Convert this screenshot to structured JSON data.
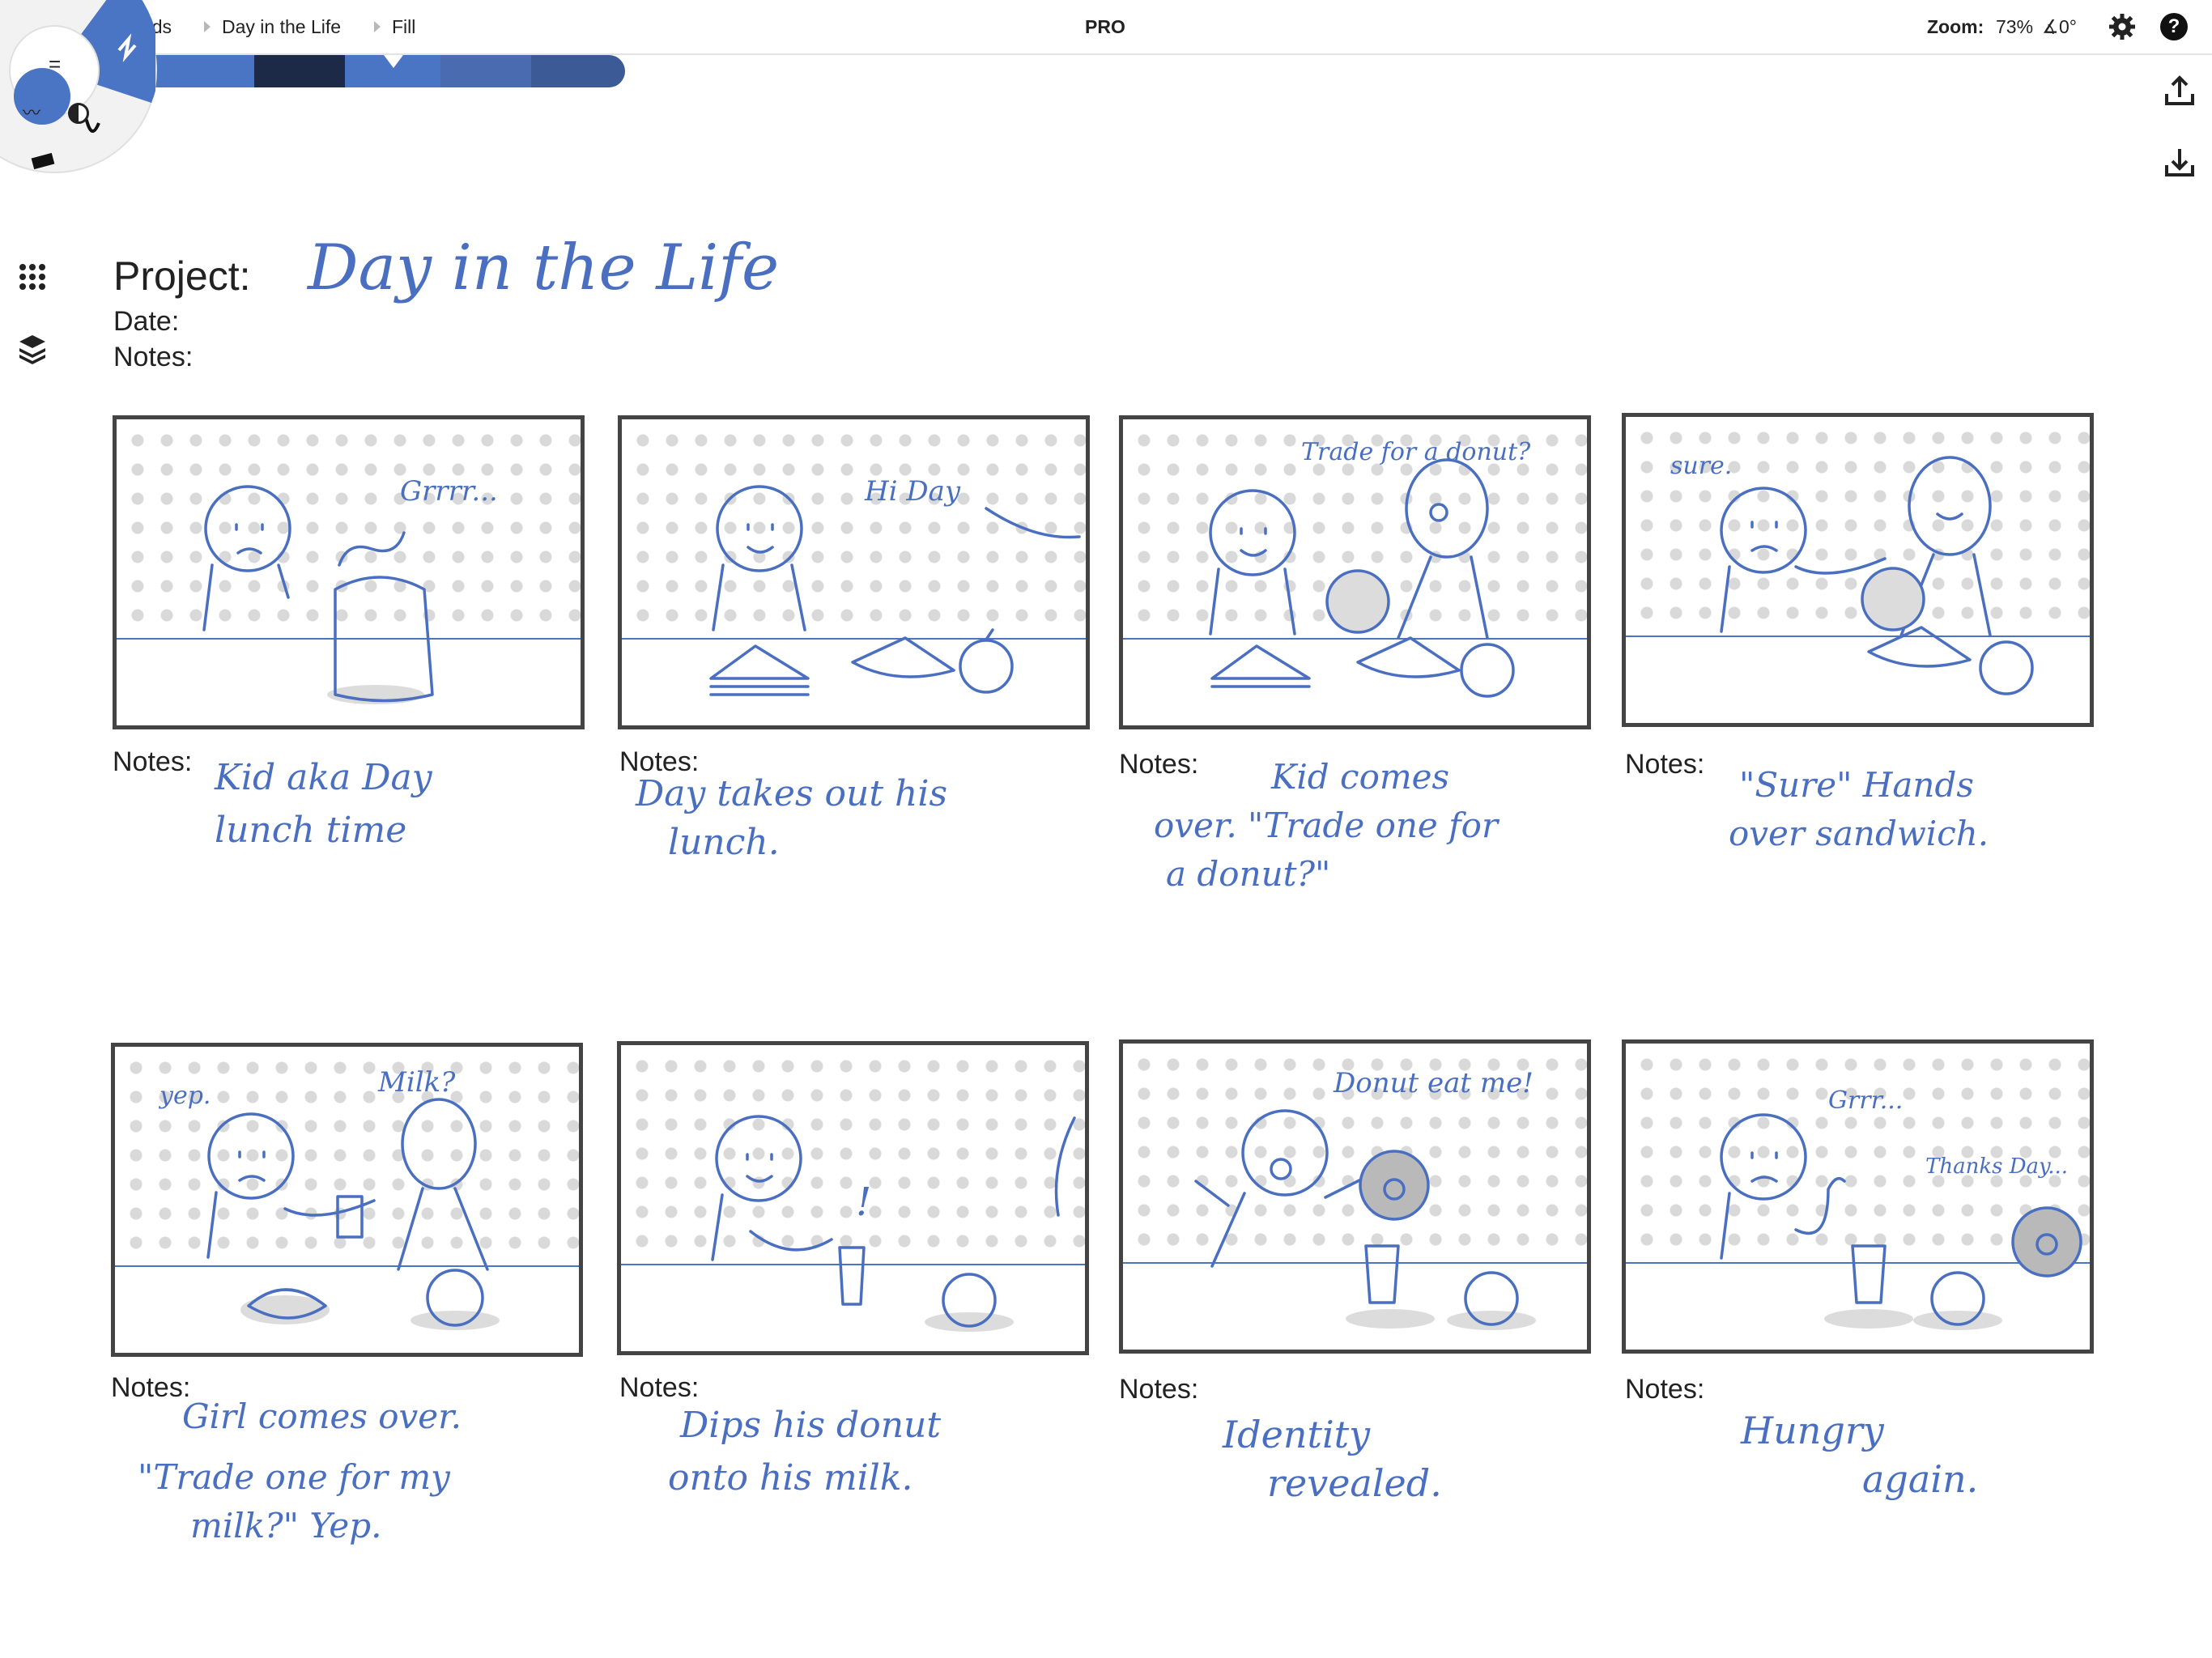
{
  "topbar": {
    "breadcrumbs": [
      "Storyboards",
      "Day in the Life",
      "Fill"
    ],
    "center_label": "PRO",
    "zoom_label": "Zoom:",
    "zoom_value": "73%",
    "angle_value": "0°"
  },
  "colors": {
    "accent": "#4a74c4",
    "ink": "#4a6fc0",
    "frame": "#444444",
    "strip": [
      "#4a74c4",
      "#1c2a48",
      "#4a74c4",
      "#4a6bb0",
      "#3c5a96"
    ]
  },
  "icons": [
    "grid-icon",
    "gear-icon",
    "help-icon",
    "upload-icon",
    "download-icon",
    "palette-grid-icon",
    "layers-icon",
    "brush-wheel-icon"
  ],
  "header": {
    "project_label": "Project:",
    "project_value": "Day in the Life",
    "date_label": "Date:",
    "notes_label": "Notes:"
  },
  "panels": [
    {
      "notes_label": "Notes:",
      "speech": "Grrrr...",
      "note_lines": [
        "Kid aka Day",
        "lunch time"
      ]
    },
    {
      "notes_label": "Notes:",
      "speech": "Hi Day",
      "note_lines": [
        "Day takes out his",
        "lunch."
      ]
    },
    {
      "notes_label": "Notes:",
      "speech": "Trade for a donut?",
      "note_lines": [
        "Kid comes",
        "over. \"Trade one for",
        "a donut?\""
      ]
    },
    {
      "notes_label": "Notes:",
      "speech": "sure.",
      "note_lines": [
        "\"Sure\" Hands",
        "over sandwich."
      ]
    },
    {
      "notes_label": "Notes:",
      "speech": "yep.",
      "speech2": "Milk?",
      "note_lines": [
        "Girl comes over.",
        "\"Trade one for my",
        "milk?\" Yep."
      ]
    },
    {
      "notes_label": "Notes:",
      "speech": "!",
      "note_lines": [
        "Dips his donut",
        "onto his milk."
      ]
    },
    {
      "notes_label": "Notes:",
      "speech": "Donut eat me!",
      "note_lines": [
        "Identity",
        "revealed."
      ]
    },
    {
      "notes_label": "Notes:",
      "speech": "Grrr...",
      "speech2": "Thanks Day...",
      "note_lines": [
        "Hungry",
        "again."
      ]
    }
  ]
}
